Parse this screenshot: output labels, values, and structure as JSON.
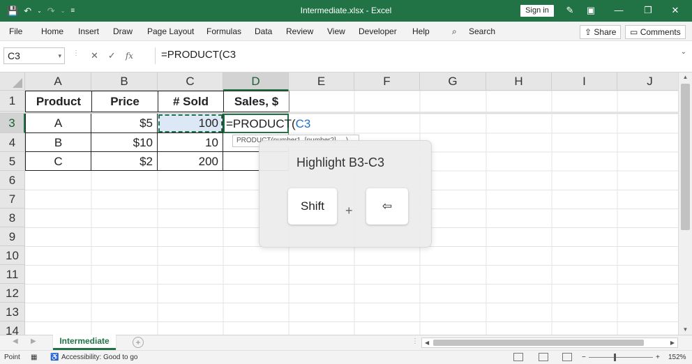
{
  "colors": {
    "brand": "#217346",
    "reference": "#1f6fd1",
    "selection_fill": "#dde8f6"
  },
  "titlebar": {
    "title": "Intermediate.xlsx  -  Excel",
    "sign_in": "Sign in",
    "icons": [
      "save-icon",
      "undo-icon",
      "redo-icon",
      "customize-icon",
      "pen-icon",
      "ribbon-display-icon",
      "minimize-icon",
      "restore-icon",
      "close-icon"
    ]
  },
  "menu": {
    "items": [
      "File",
      "Home",
      "Insert",
      "Draw",
      "Page Layout",
      "Formulas",
      "Data",
      "Review",
      "View",
      "Developer",
      "Help"
    ],
    "search": "Search",
    "share": "Share",
    "comments": "Comments"
  },
  "formula_bar": {
    "name_box": "C3",
    "cancel": "✕",
    "enter": "✓",
    "fx": "fx",
    "formula": "=PRODUCT(C3"
  },
  "grid": {
    "columns": [
      "A",
      "B",
      "C",
      "D",
      "E",
      "F",
      "G",
      "H",
      "I",
      "J"
    ],
    "rows": [
      "1",
      "3",
      "4",
      "5",
      "6",
      "7",
      "8",
      "9",
      "10",
      "11",
      "12",
      "13",
      "14"
    ],
    "headers": [
      "Product",
      "Price",
      "# Sold",
      "Sales, $"
    ],
    "data": [
      [
        "A",
        "$5",
        "100"
      ],
      [
        "B",
        "$10",
        "10"
      ],
      [
        "C",
        "$2",
        "200"
      ]
    ],
    "edit_prefix": "=PRODUCT(",
    "edit_ref": "C3",
    "tooltip": "PRODUCT(number1, [number2], ...)"
  },
  "overlay": {
    "heading": "Highlight B3-C3",
    "key1": "Shift",
    "plus": "+",
    "key2": "⇦"
  },
  "sheets": {
    "active": "Intermediate",
    "add": "+"
  },
  "status": {
    "mode": "Point",
    "accessibility": "Accessibility: Good to go",
    "zoom": "152%",
    "zoom_minus": "−",
    "zoom_plus": "+"
  }
}
